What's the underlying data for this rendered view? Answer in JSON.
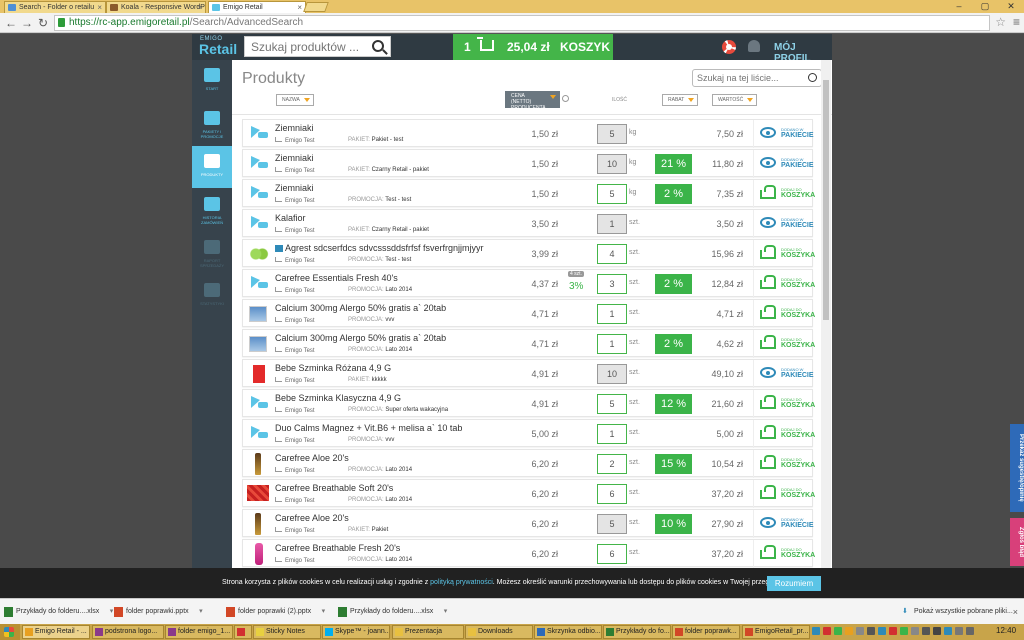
{
  "browser": {
    "tabs": [
      {
        "label": "Search - Folder o retailu",
        "color": "#4f8fd6",
        "active": false
      },
      {
        "label": "Koala - Responsive WordP",
        "color": "#8b5a2b",
        "active": false
      },
      {
        "label": "Emigo Retail",
        "color": "#5bc4e6",
        "active": true
      }
    ],
    "url_scheme": "https://",
    "url_host": "rc-app.emigoretail.pl",
    "url_path": "/Search/AdvancedSearch"
  },
  "header": {
    "logo_small": "EMIGO",
    "logo_big": "Retail",
    "search_placeholder": "Szukaj produktów ...",
    "cart_count": "1",
    "cart_total": "25,04 zł",
    "cart_label": "KOSZYK",
    "profile": "MÓJ PROFIL"
  },
  "sidebar": [
    {
      "label": "START",
      "state": "normal"
    },
    {
      "label": "PAKIETY I PROMOCJE",
      "state": "normal"
    },
    {
      "label": "PRODUKTY",
      "state": "active"
    },
    {
      "label": "HISTORIA ZAMÓWIEŃ",
      "state": "normal"
    },
    {
      "label": "RAPORT SPRZEDAŻY",
      "state": "dim"
    },
    {
      "label": "STATYSTYKI",
      "state": "dim"
    }
  ],
  "list": {
    "title": "Produkty",
    "search_placeholder": "Szukaj na tej liście...",
    "sort_name": "NAZWA",
    "sort_price": "CENA (NETTO) PRODUCENTA",
    "col_qty": "ILOŚĆ",
    "sort_discount": "RABAT",
    "sort_value": "WARTOŚĆ",
    "vendor": "Emigo Test",
    "action_top_pkg": "DODANO W",
    "action_pkg": "PAKIECIE",
    "action_top_cart": "DODAJ DO",
    "action_cart": "KOSZYKA"
  },
  "rows": [
    {
      "name": "Ziemniaki",
      "thumb": "cyan",
      "promo_key": "PAKIET:",
      "promo_val": "Pakiet - test",
      "price": "1,50 zł",
      "qty": "5",
      "qty_ro": true,
      "unit": "kg",
      "disc": "",
      "value": "7,50 zł",
      "action": "pkg"
    },
    {
      "name": "Ziemniaki",
      "thumb": "cyan",
      "promo_key": "PAKIET:",
      "promo_val": "Czarny Retail - pakiet",
      "price": "1,50 zł",
      "qty": "10",
      "qty_ro": true,
      "unit": "kg",
      "disc": "21 %",
      "value": "11,80 zł",
      "action": "pkg"
    },
    {
      "name": "Ziemniaki",
      "thumb": "cyan",
      "promo_key": "PROMOCJA:",
      "promo_val": "Test - test",
      "price": "1,50 zł",
      "qty": "5",
      "qty_ro": false,
      "unit": "kg",
      "disc": "2 %",
      "value": "7,35 zł",
      "action": "cart"
    },
    {
      "name": "Kalafior",
      "thumb": "cyan",
      "promo_key": "PAKIET:",
      "promo_val": "Czarny Retail - pakiet",
      "price": "3,50 zł",
      "qty": "1",
      "qty_ro": true,
      "unit": "szt.",
      "disc": "",
      "value": "3,50 zł",
      "action": "pkg"
    },
    {
      "name": "Agrest sdcserfdcs sdvcsssddsfrfsf fsverfrgnjjmjyyr",
      "thumb": "green",
      "badge": true,
      "promo_key": "PROMOCJA:",
      "promo_val": "Test - test",
      "price": "3,99 zł",
      "qty": "4",
      "qty_ro": false,
      "unit": "szt.",
      "disc": "",
      "value": "15,96 zł",
      "action": "cart"
    },
    {
      "name": "Carefree Essentials Fresh 40's",
      "thumb": "cyan",
      "promo_key": "PROMOCJA:",
      "promo_val": "Lato 2014",
      "price": "4,37 zł",
      "mini": "4 szt.",
      "minipct": "3%",
      "qty": "3",
      "qty_ro": false,
      "unit": "szt.",
      "disc": "2 %",
      "value": "12,84 zł",
      "action": "cart"
    },
    {
      "name": "Calcium 300mg Alergo 50% gratis a` 20tab",
      "thumb": "box",
      "promo_key": "PROMOCJA:",
      "promo_val": "vvv",
      "price": "4,71 zł",
      "qty": "1",
      "qty_ro": false,
      "unit": "szt.",
      "disc": "",
      "value": "4,71 zł",
      "action": "cart"
    },
    {
      "name": "Calcium 300mg Alergo 50% gratis a` 20tab",
      "thumb": "box",
      "promo_key": "PROMOCJA:",
      "promo_val": "Lato 2014",
      "price": "4,71 zł",
      "qty": "1",
      "qty_ro": false,
      "unit": "szt.",
      "disc": "2 %",
      "value": "4,62 zł",
      "action": "cart"
    },
    {
      "name": "Bebe Szminka Różana 4,9 G",
      "thumb": "red",
      "promo_key": "PAKIET:",
      "promo_val": "kkkkk",
      "price": "4,91 zł",
      "qty": "10",
      "qty_ro": true,
      "unit": "szt.",
      "disc": "",
      "value": "49,10 zł",
      "action": "pkg"
    },
    {
      "name": "Bebe Szminka Klasyczna 4,9 G",
      "thumb": "cyan",
      "promo_key": "PROMOCJA:",
      "promo_val": "Super oferta wakacyjna",
      "price": "4,91 zł",
      "qty": "5",
      "qty_ro": false,
      "unit": "szt.",
      "disc": "12 %",
      "value": "21,60 zł",
      "action": "cart"
    },
    {
      "name": "Duo Calms Magnez + Vit.B6 + melisa a` 10 tab",
      "thumb": "cyan",
      "promo_key": "PROMOCJA:",
      "promo_val": "vvv",
      "price": "5,00 zł",
      "qty": "1",
      "qty_ro": false,
      "unit": "szt.",
      "disc": "",
      "value": "5,00 zł",
      "action": "cart"
    },
    {
      "name": "Carefree Aloe 20's",
      "thumb": "bottle",
      "promo_key": "PROMOCJA:",
      "promo_val": "Lato 2014",
      "price": "6,20 zł",
      "qty": "2",
      "qty_ro": false,
      "unit": "szt.",
      "disc": "15 %",
      "value": "10,54 zł",
      "action": "cart"
    },
    {
      "name": "Carefree Breathable Soft 20's",
      "thumb": "redbag",
      "promo_key": "PROMOCJA:",
      "promo_val": "Lato 2014",
      "price": "6,20 zł",
      "qty": "6",
      "qty_ro": false,
      "unit": "szt.",
      "disc": "",
      "value": "37,20 zł",
      "action": "cart"
    },
    {
      "name": "Carefree Aloe 20's",
      "thumb": "bottle",
      "promo_key": "PAKIET:",
      "promo_val": "Pakiet",
      "price": "6,20 zł",
      "qty": "5",
      "qty_ro": true,
      "unit": "szt.",
      "disc": "10 %",
      "value": "27,90 zł",
      "action": "pkg"
    },
    {
      "name": "Carefree Breathable Fresh 20's",
      "thumb": "pink",
      "promo_key": "PROMOCJA:",
      "promo_val": "Lato 2014",
      "price": "6,20 zł",
      "qty": "6",
      "qty_ro": false,
      "unit": "szt.",
      "disc": "",
      "value": "37,20 zł",
      "action": "cart"
    }
  ],
  "cookie": {
    "text_before": "Strona korzysta z plików cookies w celu realizacji usług i zgodnie z ",
    "link": "polityką prywatności",
    "text_after": ". Możesz określić warunki przechowywania lub dostępu do plików cookies w Twojej przeglądarce.",
    "button": "Rozumiem"
  },
  "side_tabs": {
    "feedback": "Przekaż sugestię/opinię",
    "report": "Zgłoś błąd"
  },
  "downloads": {
    "items": [
      {
        "name": "Przykłady do folderu....xlsx",
        "color": "#2e7d32"
      },
      {
        "name": "folder poprawki.pptx",
        "color": "#d24726"
      },
      {
        "name": "folder poprawki (2).pptx",
        "color": "#d24726"
      },
      {
        "name": "Przykłady do folderu....xlsx",
        "color": "#2e7d32"
      }
    ],
    "show_all": "Pokaż wszystkie pobrane pliki..."
  },
  "taskbar": {
    "items": [
      {
        "label": "Emigo Retail - ...",
        "color": "#e8a020",
        "active": true
      },
      {
        "label": "podstrona logo...",
        "color": "#8a3a8a",
        "active": false
      },
      {
        "label": "folder emigo_1...",
        "color": "#8a3a8a",
        "active": false
      },
      {
        "label": "",
        "color": "#d23030",
        "active": false
      },
      {
        "label": "Sticky Notes",
        "color": "#e8d040",
        "active": false
      },
      {
        "label": "Skype™ - joann...",
        "color": "#00aff0",
        "active": false
      },
      {
        "label": "Prezentacja",
        "color": "#e8c040",
        "active": false
      },
      {
        "label": "Downloads",
        "color": "#e8c040",
        "active": false
      },
      {
        "label": "Skrzynka odbio...",
        "color": "#2e6ab8",
        "active": false
      },
      {
        "label": "Przykłady do fo...",
        "color": "#2e7d32",
        "active": false
      },
      {
        "label": "folder poprawk...",
        "color": "#d24726",
        "active": false
      },
      {
        "label": "EmigoRetail_pr...",
        "color": "#d24726",
        "active": false
      }
    ],
    "clock": "12:40",
    "tray_colors": [
      "#2e8ab8",
      "#d23030",
      "#3bb449",
      "#e8a020",
      "#888888",
      "#555555",
      "#2e8ab8",
      "#d23030",
      "#3bb449",
      "#888888",
      "#555555",
      "#444444",
      "#2e8ab8",
      "#777777",
      "#666666"
    ]
  }
}
